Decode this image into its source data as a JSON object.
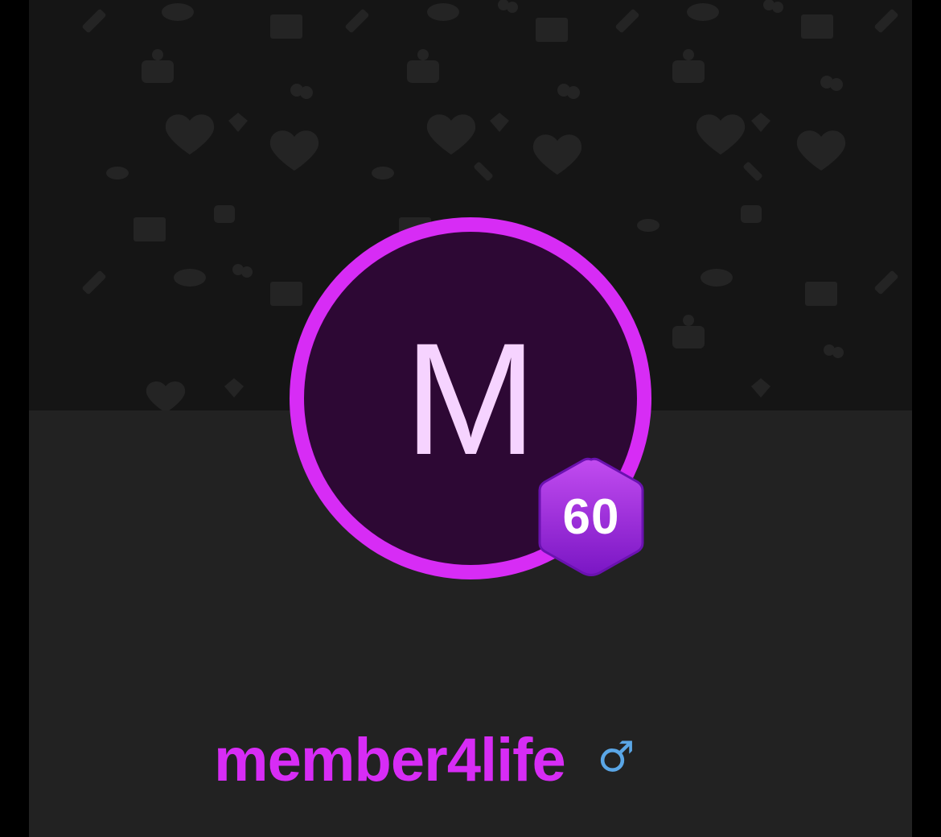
{
  "profile": {
    "avatar_initial": "M",
    "level": "60",
    "username": "member4life",
    "gender_symbol": "♂",
    "gender_icon": "male-symbol-icon"
  },
  "colors": {
    "accent": "#d72cf5",
    "avatar_fill": "#2d0834",
    "avatar_initial": "#f6d3ff",
    "badge_top": "#c24cf0",
    "badge_bottom": "#7a16c4",
    "gender": "#5aa6e6",
    "cover_bg": "#151515",
    "page_bg": "#222222"
  },
  "cover": {
    "pattern_icons": [
      "heart-icon",
      "lips-icon",
      "envelope-icon",
      "cherry-icon",
      "lipstick-icon",
      "gift-icon"
    ]
  }
}
